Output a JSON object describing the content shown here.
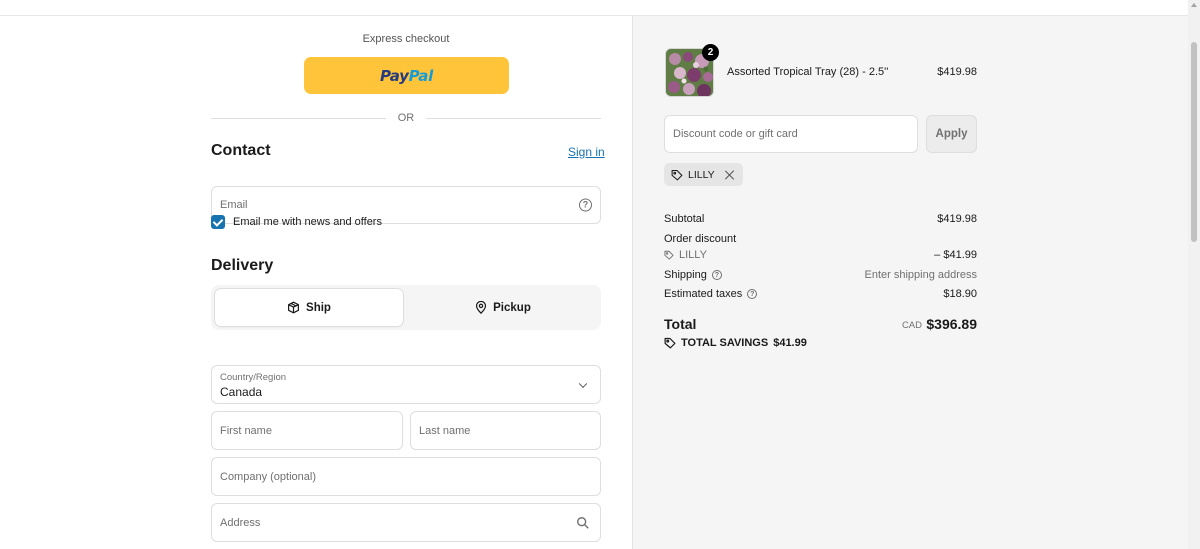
{
  "express": {
    "label": "Express checkout",
    "paypal_part1": "Pay",
    "paypal_part2": "Pal"
  },
  "divider": {
    "or_text": "OR"
  },
  "contact": {
    "title": "Contact",
    "signin_label": "Sign in",
    "email_placeholder": "Email",
    "newsletter_label": "Email me with news and offers",
    "newsletter_checked": true
  },
  "delivery": {
    "title": "Delivery",
    "options": [
      {
        "label": "Ship",
        "active": true
      },
      {
        "label": "Pickup",
        "active": false
      }
    ],
    "country_label": "Country/Region",
    "country_value": "Canada",
    "first_name_placeholder": "First name",
    "last_name_placeholder": "Last name",
    "company_placeholder": "Company (optional)",
    "address_placeholder": "Address"
  },
  "order": {
    "product": {
      "name": "Assorted Tropical Tray (28) - 2.5''",
      "price": "$419.98",
      "quantity": "2"
    },
    "discount_placeholder": "Discount code or gift card",
    "apply_label": "Apply",
    "applied_code": "LILLY",
    "summary": {
      "subtotal_label": "Subtotal",
      "subtotal_value": "$419.98",
      "order_discount_label": "Order discount",
      "discount_code": "LILLY",
      "discount_value": "– $41.99",
      "shipping_label": "Shipping",
      "shipping_value": "Enter shipping address",
      "taxes_label": "Estimated taxes",
      "taxes_value": "$18.90",
      "total_label": "Total",
      "total_currency": "CAD",
      "total_value": "$396.89",
      "savings_label": "TOTAL SAVINGS",
      "savings_value": "$41.99"
    }
  },
  "colors": {
    "paypal_yellow": "#ffc439",
    "link_blue": "#1773b0",
    "summary_bg": "#f5f5f5"
  }
}
